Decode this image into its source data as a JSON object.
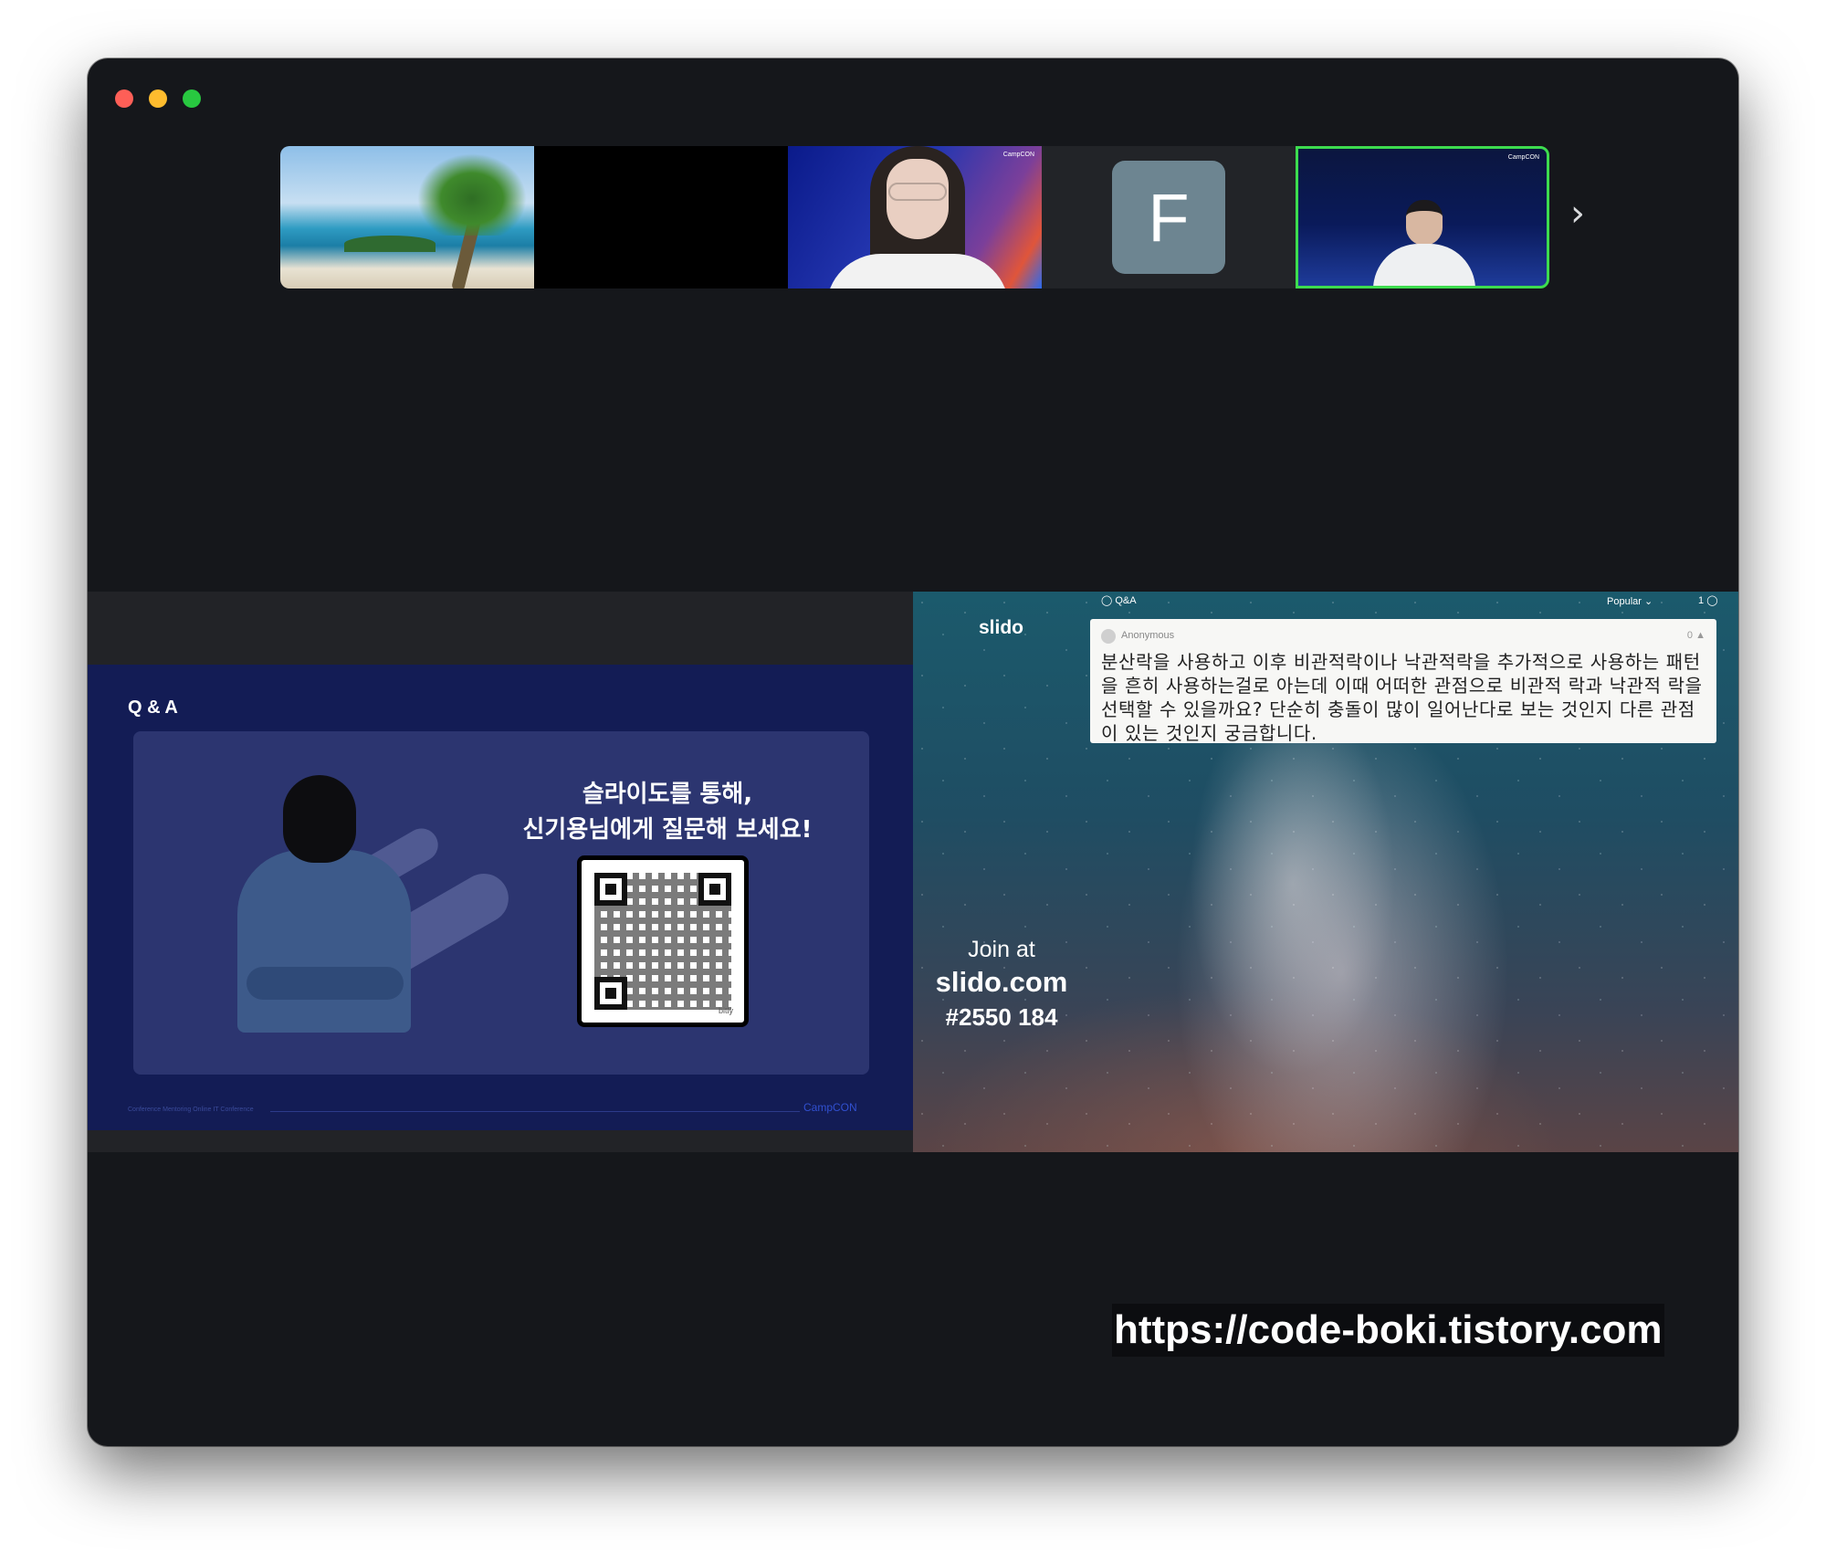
{
  "window": {
    "traffic_lights": {
      "close": "#fe5f57",
      "minimize": "#febc2e",
      "zoom": "#28c840"
    }
  },
  "participants": {
    "tiles": [
      {
        "kind": "beach-background"
      },
      {
        "kind": "video-off"
      },
      {
        "kind": "camera",
        "brand": "CampCON"
      },
      {
        "kind": "avatar",
        "initial": "F",
        "avatar_color": "#6d8591"
      },
      {
        "kind": "camera",
        "brand": "CampCON",
        "active_speaker": true,
        "highlight_color": "#3ddc4f"
      }
    ],
    "next_icon": "chevron-right-icon"
  },
  "slide": {
    "title": "Q & A",
    "headline_line1": "슬라이도를 통해,",
    "headline_line2": "신기용님에게 질문해 보세요!",
    "qr_caption": "bitly",
    "footer_left": "Conference Mentoring Online IT Conference",
    "footer_right": "CampCON"
  },
  "slido": {
    "tab_label": "Q&A",
    "sort_label": "Popular",
    "question_count": "1",
    "logo": "slido",
    "question": {
      "author": "Anonymous",
      "likes": "0",
      "text": "분산락을 사용하고 이후 비관적락이나 낙관적락을 추가적으로 사용하는 패턴을 흔히 사용하는걸로 아는데 이때 어떠한 관점으로 비관적 락과 낙관적 락을 선택할 수 있을까요? 단순히 충돌이 많이 일어난다로 보는 것인지 다른 관점이 있는 것인지 궁금합니다."
    },
    "join_at": "Join at",
    "join_url": "slido.com",
    "event_code": "#2550 184"
  },
  "watermark": "https://code-boki.tistory.com"
}
